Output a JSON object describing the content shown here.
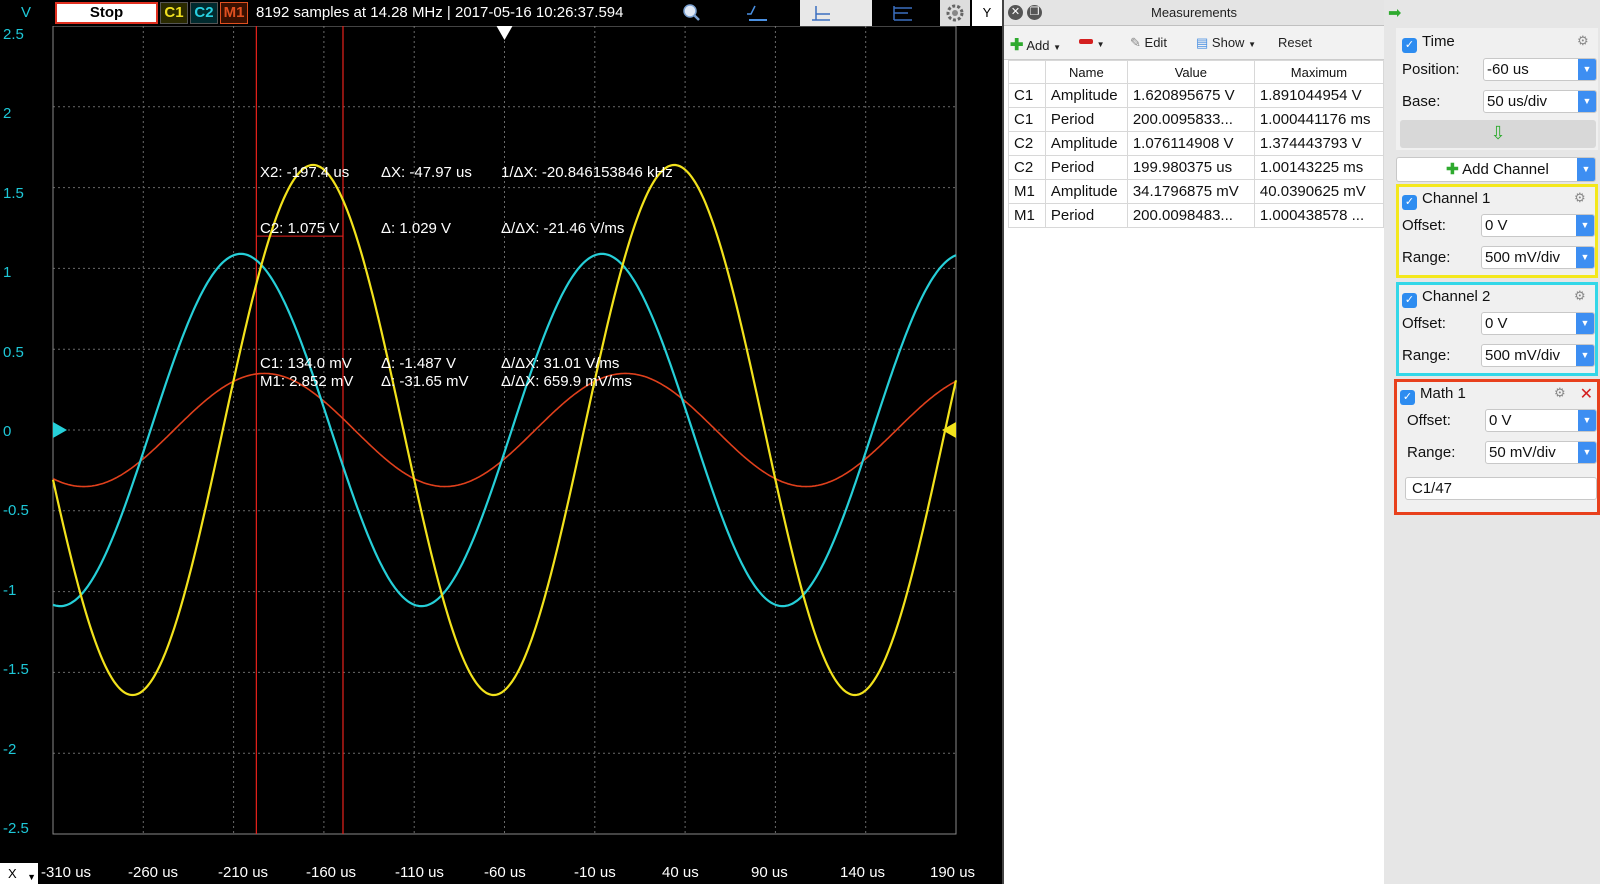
{
  "toolbar": {
    "y_unit": "V",
    "stop_label": "Stop",
    "badges": [
      "C1",
      "C2",
      "M1"
    ],
    "status": "8192 samples at 14.28 MHz | 2017-05-16 10:26:37.594",
    "y_button": "Y",
    "icons": [
      "zoom-icon",
      "trigger-edge-icon",
      "cursor-horizontal-icon",
      "cursor-vertical-icon",
      "settings-icon"
    ]
  },
  "plot": {
    "y_ticks": [
      "2.5",
      "2",
      "1.5",
      "1",
      "0.5",
      "0",
      "-0.5",
      "-1",
      "-1.5",
      "-2",
      "-2.5"
    ],
    "x_ticks": [
      "-310 us",
      "-260 us",
      "-210 us",
      "-160 us",
      "-110 us",
      "-60 us",
      "-10 us",
      "40 us",
      "90 us",
      "140 us",
      "190 us"
    ],
    "x_button": "X",
    "colors": {
      "c1": "#f2e21c",
      "c2": "#26cfd8",
      "m1": "#e0401c",
      "cursor": "#e8221c",
      "grid": "#6a6a6a"
    },
    "readouts": {
      "x2": "X2: -197.4 us",
      "dx": "ΔX: -47.97 us",
      "inv_dx": "1/ΔX: -20.846153846 kHz",
      "c2": "C2: 1.075 V",
      "c2_delta": "Δ: 1.029 V",
      "c2_rate": "Δ/ΔX: -21.46 V/ms",
      "c1": "C1: 134.0 mV",
      "c1_delta": "Δ: -1.487 V",
      "c1_rate": "Δ/ΔX: 31.01 V/ms",
      "m1": "M1: 2.852 mV",
      "m1_delta": "Δ: -31.65 mV",
      "m1_rate": "Δ/ΔX: 659.9 mV/ms"
    }
  },
  "measurements": {
    "title": "Measurements",
    "toolbar": {
      "add": "Add",
      "edit": "Edit",
      "show": "Show",
      "reset": "Reset"
    },
    "columns": [
      "",
      "Name",
      "Value",
      "Maximum"
    ],
    "rows": [
      [
        "C1",
        "Amplitude",
        "1.620895675 V",
        "1.891044954 V"
      ],
      [
        "C1",
        "Period",
        "200.0095833...",
        "1.000441176 ms"
      ],
      [
        "C2",
        "Amplitude",
        "1.076114908 V",
        "1.374443793 V"
      ],
      [
        "C2",
        "Period",
        "199.980375 us",
        "1.00143225 ms"
      ],
      [
        "M1",
        "Amplitude",
        "34.1796875 mV",
        "40.0390625 mV"
      ],
      [
        "M1",
        "Period",
        "200.0098483...",
        "1.000438578 ..."
      ]
    ]
  },
  "settings": {
    "time": {
      "title": "Time",
      "position_label": "Position:",
      "position": "-60 us",
      "base_label": "Base:",
      "base": "50 us/div"
    },
    "add_channel": "Add Channel",
    "channel1": {
      "title": "Channel 1",
      "offset_label": "Offset:",
      "offset": "0 V",
      "range_label": "Range:",
      "range": "500 mV/div",
      "color": "#f4e81c"
    },
    "channel2": {
      "title": "Channel 2",
      "offset_label": "Offset:",
      "offset": "0 V",
      "range_label": "Range:",
      "range": "500 mV/div",
      "color": "#33d7e8"
    },
    "math1": {
      "title": "Math 1",
      "offset_label": "Offset:",
      "offset": "0 V",
      "range_label": "Range:",
      "range": "50 mV/div",
      "expression": "C1/47",
      "color": "#e8401c"
    }
  }
}
